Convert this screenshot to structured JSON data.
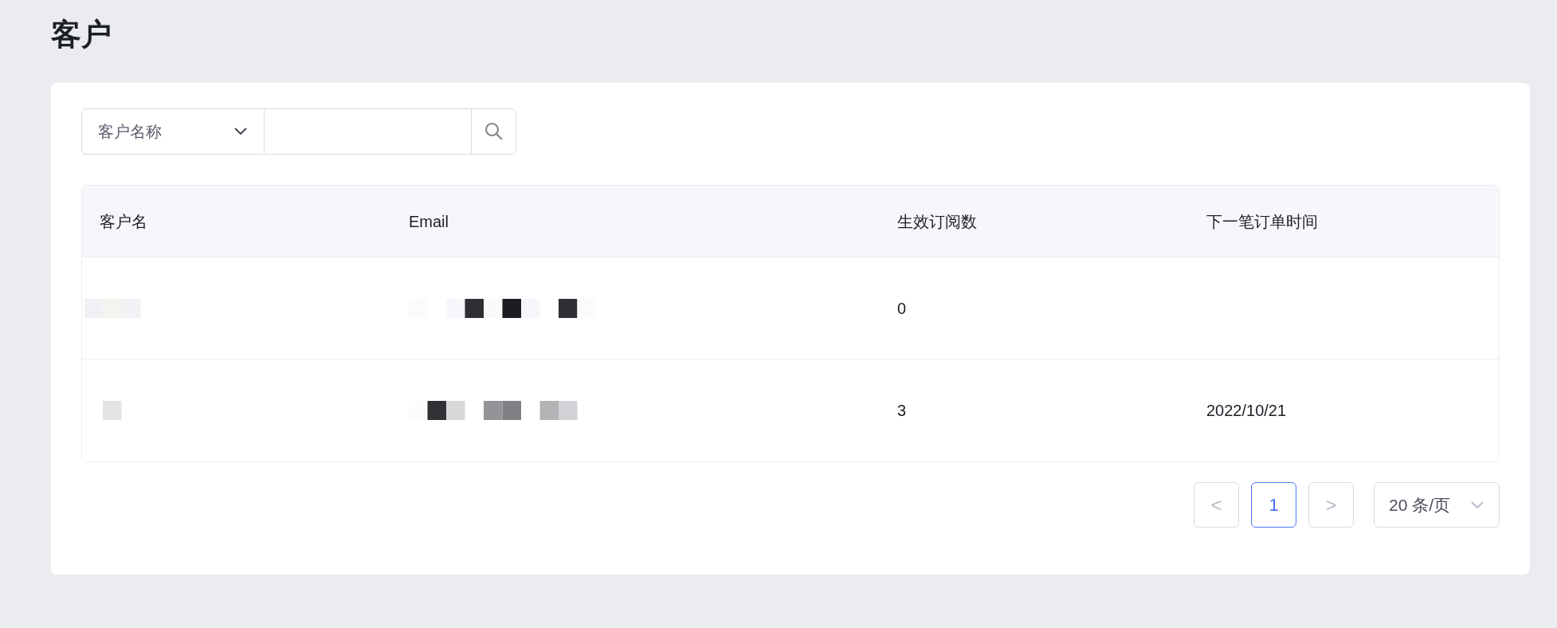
{
  "page_title": "客户",
  "search": {
    "field_select": "客户名称"
  },
  "table": {
    "columns": [
      "客户名",
      "Email",
      "生效订阅数",
      "下一笔订单时间"
    ],
    "rows": [
      {
        "name_redacted": true,
        "email_redacted": true,
        "active_subscriptions": "0"
      },
      {
        "name_redacted": true,
        "email_redacted": true,
        "active_subscriptions": "3",
        "next_order_date": "2022/10/21"
      }
    ]
  },
  "pagination": {
    "prev": "<",
    "pages": [
      {
        "label": "1",
        "selected": true
      }
    ],
    "next": ">",
    "page_size": "20 条/页"
  }
}
